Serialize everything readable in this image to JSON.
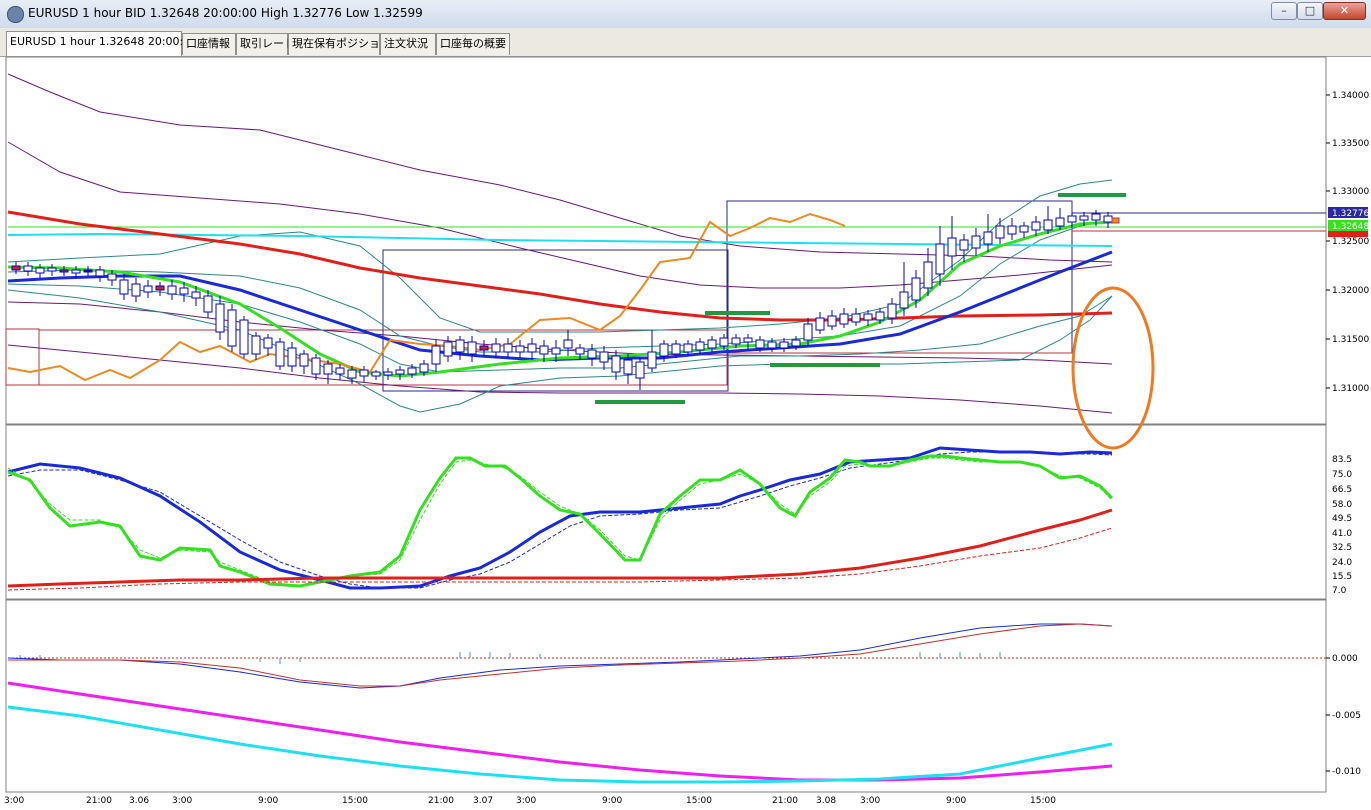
{
  "window": {
    "title": "EURUSD 1 hour BID 1.32648 20:00:00 High 1.32776 Low 1.32599",
    "buttons": {
      "minimize": "–",
      "maximize": "□",
      "close": "✕"
    }
  },
  "tabs": [
    {
      "label": "EURUSD 1 hour 1.32648 20:00:00",
      "active": true
    },
    {
      "label": "口座情報",
      "active": false
    },
    {
      "label": "取引レート",
      "active": false
    },
    {
      "label": "現在保有ポジション",
      "active": false
    },
    {
      "label": "注文状況",
      "active": false
    },
    {
      "label": "口座毎の概要",
      "active": false
    }
  ],
  "price_axis": {
    "labels": [
      "1.34000",
      "1.33500",
      "1.33000",
      "1.32500",
      "1.32000",
      "1.31500",
      "1.31000"
    ],
    "high_badge": "1.32776",
    "current_badge": "1.32648",
    "low_badge": "1.32599"
  },
  "stoch_axis": {
    "labels": [
      "83.5",
      "75.0",
      "66.5",
      "58.0",
      "49.5",
      "41.0",
      "32.5",
      "24.0",
      "15.5",
      "7.0"
    ]
  },
  "macd_axis": {
    "labels": [
      "0.000",
      "-0.005",
      "-0.010"
    ]
  },
  "time_axis": {
    "labels": [
      "3:00",
      "21:00",
      "3.06",
      "3:00",
      "9:00",
      "15:00",
      "21:00",
      "3.07",
      "3:00",
      "9:00",
      "15:00",
      "21:00",
      "3.08",
      "3:00",
      "9:00",
      "15:00"
    ]
  },
  "colors": {
    "candle_up_body": "#ffffff",
    "candle_down_body": "#ffffff",
    "candle_outline": "#0000cc",
    "ema_red": "#e0201a",
    "ema_blue": "#1a2ad8",
    "ema_green": "#34e020",
    "orange_line": "#f08a20",
    "cyan_line": "#20e0f0",
    "purple_band": "#6a1a7a",
    "teal_band": "#2a8a8a",
    "magenta_line": "#ee20ee",
    "green_markers": "#1f9a40",
    "orange_annotation": "#f07a20"
  }
}
